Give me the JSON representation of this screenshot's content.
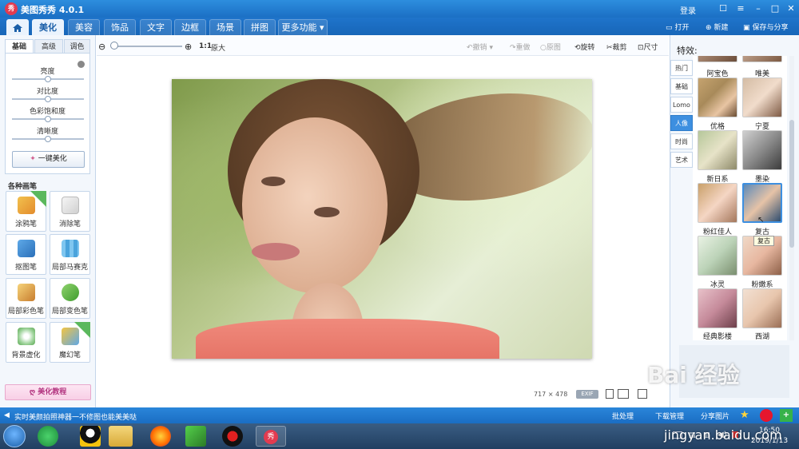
{
  "window": {
    "title": "美图秀秀 4.0.1",
    "login": "登录",
    "logo_text": "秀"
  },
  "tabs": [
    {
      "label": ""
    },
    {
      "label": "美化"
    },
    {
      "label": "美容"
    },
    {
      "label": "饰品"
    },
    {
      "label": "文字"
    },
    {
      "label": "边框"
    },
    {
      "label": "场景"
    },
    {
      "label": "拼图"
    },
    {
      "label": "更多功能 ▾"
    }
  ],
  "top_actions": {
    "open": "打开",
    "new": "新建",
    "save": "保存与分享"
  },
  "left_panel": {
    "tabs": [
      "基础",
      "高级",
      "调色"
    ],
    "adjustments": [
      {
        "label": "亮度",
        "value": 0.5
      },
      {
        "label": "对比度",
        "value": 0.5
      },
      {
        "label": "色彩饱和度",
        "value": 0.5
      },
      {
        "label": "清晰度",
        "value": 0.5
      }
    ],
    "one_key": "一键美化",
    "brushes_title": "各种画笔",
    "brushes": [
      {
        "label": "涂鸦笔",
        "badge": "升级"
      },
      {
        "label": "消除笔",
        "badge": ""
      },
      {
        "label": "抠图笔",
        "badge": ""
      },
      {
        "label": "局部马赛克",
        "badge": ""
      },
      {
        "label": "局部彩色笔",
        "badge": ""
      },
      {
        "label": "局部变色笔",
        "badge": ""
      },
      {
        "label": "背景虚化",
        "badge": ""
      },
      {
        "label": "魔幻笔",
        "badge": "new"
      }
    ],
    "tutorial": "美化教程"
  },
  "toolbar": {
    "zoom_ratio": "1:1",
    "original": "原大",
    "undo": "撤销",
    "redo": "重做",
    "orig_img": "原图",
    "rotate": "旋转",
    "crop": "裁剪",
    "size": "尺寸"
  },
  "image": {
    "width": "717",
    "sep": "×",
    "height": "478",
    "exif": "EXIF"
  },
  "right_panel": {
    "title": "特效:",
    "categories": [
      "热门",
      "基础",
      "Lomo",
      "人像",
      "时尚",
      "艺术"
    ],
    "active_category": "人像",
    "effects": [
      "阿宝色",
      "唯美",
      "优格",
      "宁夏",
      "新日系",
      "墨染",
      "粉红佳人",
      "复古",
      "冰灵",
      "粉嫩系",
      "经典影楼",
      "西湖"
    ],
    "selected_effect": "复古",
    "tooltip": "复古"
  },
  "status": {
    "text": "实时美颜拍照神器一不修图也能美美哒",
    "batch": "批处理",
    "download": "下载管理",
    "share": "分享图片"
  },
  "taskbar": {
    "time": "16:50",
    "date": "2019/1/13"
  },
  "watermark": {
    "brand": "Bai 经验",
    "url": "jingyan.baidu.com"
  }
}
